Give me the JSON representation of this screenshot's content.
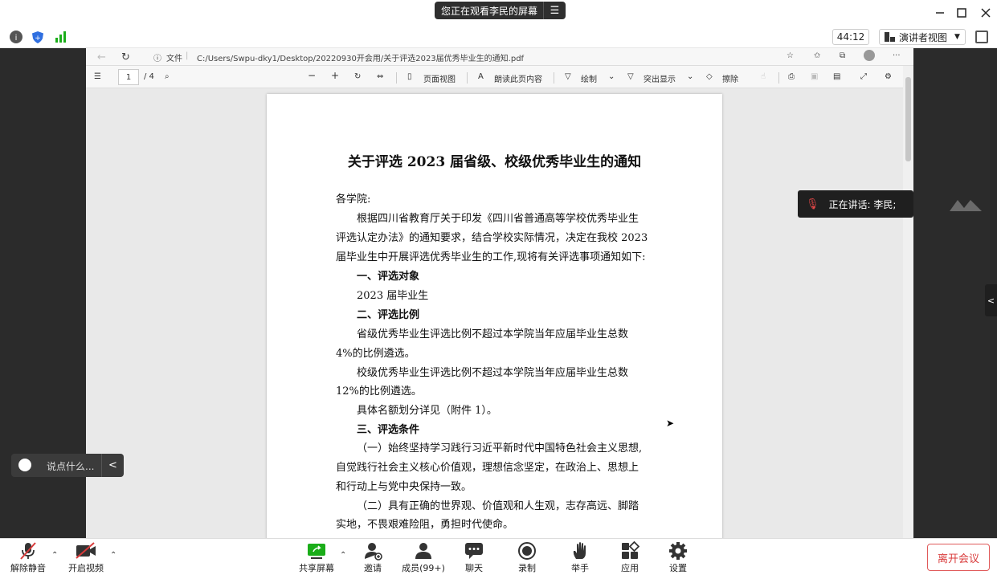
{
  "titlebar": {
    "share_banner": "您正在观看李民的屏幕",
    "menu_glyph": "☰"
  },
  "infobar": {
    "timer": "44:12",
    "view_button": "演讲者视图"
  },
  "browser": {
    "file_label": "文件",
    "url": "C:/Users/Swpu-dky1/Desktop/20220930开会用/关于评选2023届优秀毕业生的通知.pdf"
  },
  "pdf_toolbar": {
    "page_current": "1",
    "page_total": "/ 4",
    "page_view": "页面视图",
    "read_aloud": "朗读此页内容",
    "draw": "绘制",
    "highlight": "突出显示",
    "erase": "擦除"
  },
  "document": {
    "title": "关于评选 2023 届省级、校级优秀毕业生的通知",
    "lines": [
      "各学院:",
      "根据四川省教育厅关于印发《四川省普通高等学校优秀毕业生",
      "评选认定办法》的通知要求，结合学校实际情况，决定在我校 2023",
      "届毕业生中开展评选优秀毕业生的工作,现将有关评选事项通知如下:",
      "一、评选对象",
      "2023 届毕业生",
      "二、评选比例",
      "省级优秀毕业生评选比例不超过本学院当年应届毕业生总数",
      "4%的比例遴选。",
      "校级优秀毕业生评选比例不超过本学院当年应届毕业生总数",
      "12%的比例遴选。",
      "具体名额划分详见（附件 1）。",
      "三、评选条件",
      "（一）始终坚持学习践行习近平新时代中国特色社会主义思想,",
      "自觉践行社会主义核心价值观，理想信念坚定，在政治上、思想上",
      "和行动上与党中央保持一致。",
      "（二）具有正确的世界观、价值观和人生观，志存高远、脚踏",
      "实地，不畏艰难险阻，勇担时代使命。"
    ]
  },
  "overlays": {
    "speaking": "正在讲话: 李民;",
    "chat_placeholder": "说点什么..."
  },
  "bottombar": {
    "unmute": "解除静音",
    "start_video": "开启视频",
    "share_screen": "共享屏幕",
    "invite": "邀请",
    "members": "成员(99+)",
    "chat": "聊天",
    "record": "录制",
    "raise_hand": "举手",
    "apps": "应用",
    "settings": "设置",
    "leave": "离开会议"
  },
  "colors": {
    "accent_green": "#1aad19",
    "danger_red": "#d93b3b",
    "shield_blue": "#2f6fe0"
  }
}
